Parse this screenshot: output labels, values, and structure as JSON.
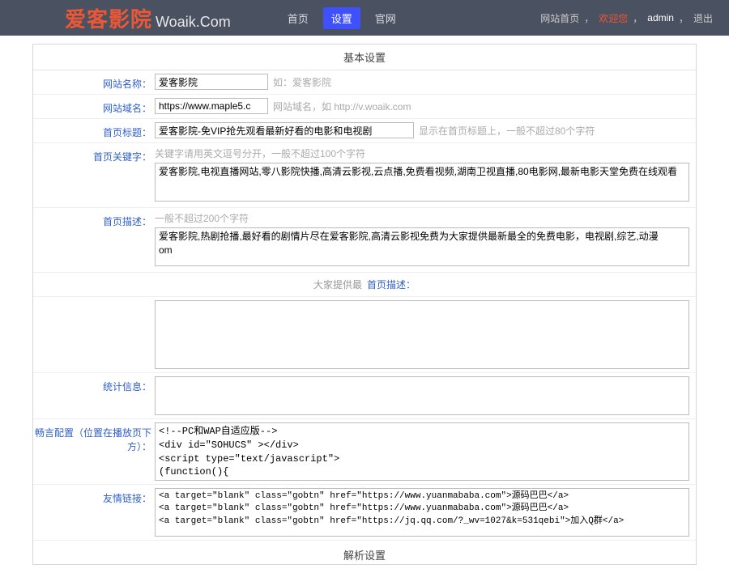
{
  "header": {
    "logo_cn": "爱客影院",
    "logo_en": "Woaik.Com",
    "nav": {
      "home": "首页",
      "settings": "设置",
      "official": "官网"
    },
    "right": {
      "site_home": "网站首页",
      "welcome": "欢迎您",
      "user": "admin",
      "sep": "，",
      "logout": "退出"
    }
  },
  "section": {
    "title": "基本设置",
    "footer": "解析设置"
  },
  "rows": {
    "site_name": {
      "label": "网站名称：",
      "value": "爱客影院",
      "hint": "如：爱客影院"
    },
    "domain": {
      "label": "网站域名：",
      "value": "https://www.maple5.c",
      "hint": "网站域名，如 http://v.woaik.com"
    },
    "title": {
      "label": "首页标题：",
      "value": "爱客影院-免VIP抢先观看最新好看的电影和电视剧",
      "hint": "显示在首页标题上，一般不超过80个字符"
    },
    "keywords": {
      "label": "首页关键字：",
      "hint_top": "关键字请用英文逗号分开，一般不超过100个字符",
      "value": "爱客影院,电视直播网站,零八影院快播,高清云影视,云点播,免费看视频,湖南卫视直播,80电影网,最新电影天堂免费在线观看"
    },
    "desc": {
      "label": "首页描述：",
      "hint_top": "一般不超过200个字符",
      "value": "爱客影院,热剧抢播,最好看的剧情片尽在爱客影院,高清云影视免费为大家提供最新最全的免费电影，电视剧,综艺,动漫               om"
    },
    "overlay": {
      "text": "大家提供最",
      "label": "首页描述："
    },
    "stats": {
      "label": "统计信息：",
      "value": ""
    },
    "comments": {
      "label": "畅言配置（位置在播放页下方）：",
      "value": "<!--PC和WAP自适应版-->\n<div id=\"SOHUCS\" ></div>\n<script type=\"text/javascript\">\n(function(){\nvar appid = 'cysHhpVdt';"
    },
    "links": {
      "label": "友情链接：",
      "value": "<a target=\"blank\" class=\"gobtn\" href=\"https://www.yuanmababa.com\">源码巴巴</a>\n<a target=\"blank\" class=\"gobtn\" href=\"https://www.yuanmababa.com\">源码巴巴</a>\n<a target=\"blank\" class=\"gobtn\" href=\"https://jq.qq.com/?_wv=1027&k=531qebi\">加入Q群</a>"
    }
  }
}
